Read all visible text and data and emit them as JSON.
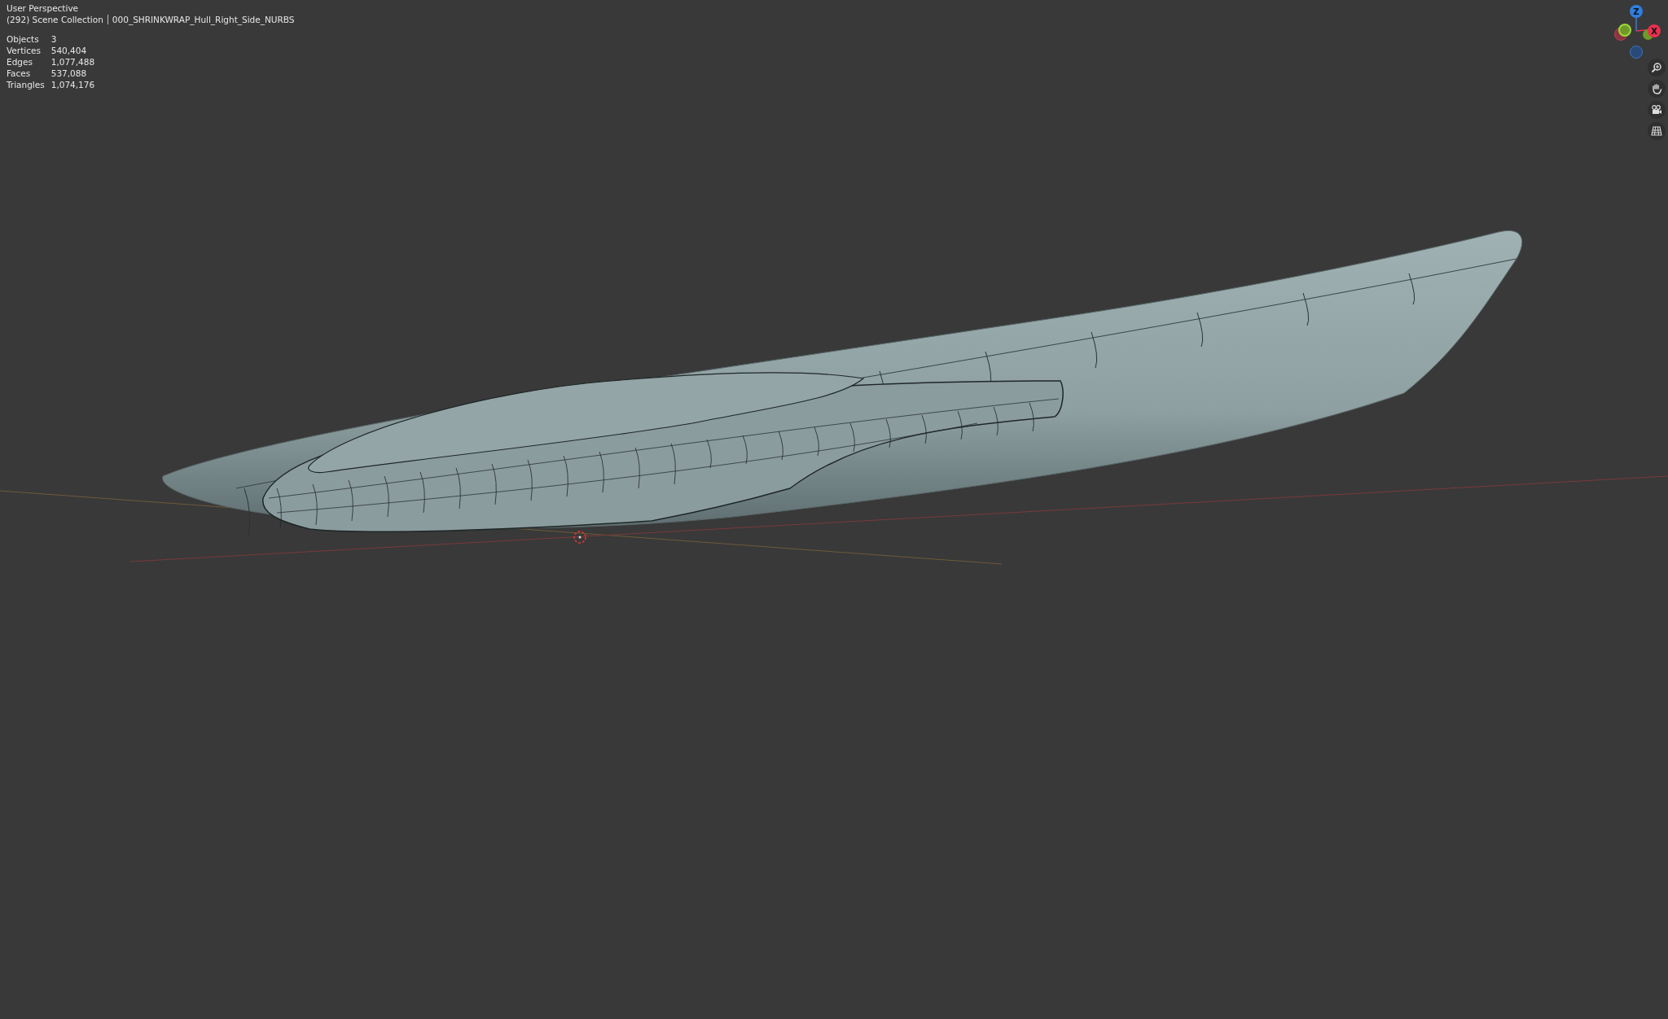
{
  "viewport": {
    "view_name": "User Perspective",
    "collection": "(292) Scene Collection",
    "object_name": "000_SHRINKWRAP_Hull_Right_Side_NURBS"
  },
  "statistics": [
    {
      "label": "Objects",
      "value": "3"
    },
    {
      "label": "Vertices",
      "value": "540,404"
    },
    {
      "label": "Edges",
      "value": "1,077,488"
    },
    {
      "label": "Faces",
      "value": "537,088"
    },
    {
      "label": "Triangles",
      "value": "1,074,176"
    }
  ],
  "gizmo": {
    "axes": [
      {
        "label": "Z",
        "color": "#2f7ee0"
      },
      {
        "label": "X",
        "color": "#e8304f"
      }
    ]
  },
  "nav_buttons": [
    {
      "kind": "zoom"
    },
    {
      "kind": "pan"
    },
    {
      "kind": "camera"
    },
    {
      "kind": "grid"
    }
  ]
}
